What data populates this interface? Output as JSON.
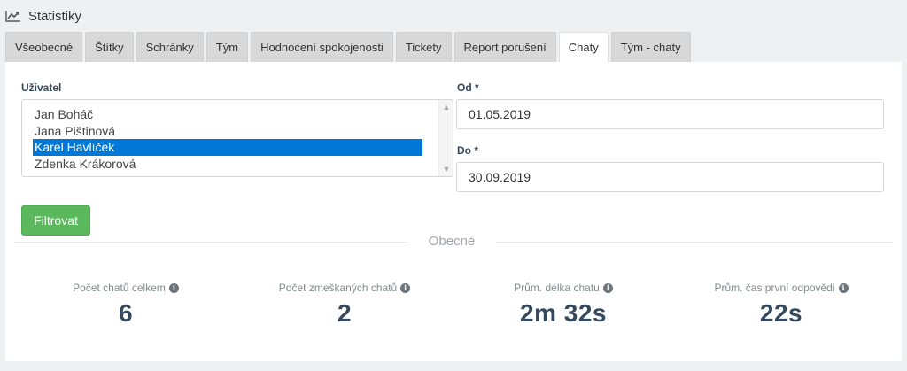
{
  "header": {
    "title": "Statistiky",
    "icon": "line-chart-icon"
  },
  "tabs": [
    {
      "label": "Všeobecné",
      "active": false
    },
    {
      "label": "Štítky",
      "active": false
    },
    {
      "label": "Schránky",
      "active": false
    },
    {
      "label": "Tým",
      "active": false
    },
    {
      "label": "Hodnocení spokojenosti",
      "active": false
    },
    {
      "label": "Tickety",
      "active": false
    },
    {
      "label": "Report porušení",
      "active": false
    },
    {
      "label": "Chaty",
      "active": true
    },
    {
      "label": "Tým - chaty",
      "active": false
    }
  ],
  "filters": {
    "user_label": "Uživatel",
    "users": [
      {
        "name": "Jan Boháč",
        "selected": false
      },
      {
        "name": "Jana Pištinová",
        "selected": false
      },
      {
        "name": "Karel Havlíček",
        "selected": true
      },
      {
        "name": "Zdenka Krákorová",
        "selected": false
      }
    ],
    "from_label": "Od *",
    "from_value": "01.05.2019",
    "to_label": "Do *",
    "to_value": "30.09.2019",
    "filter_button": "Filtrovat"
  },
  "section": {
    "title": "Obecné"
  },
  "stats": [
    {
      "label": "Počet chatů celkem",
      "value": "6"
    },
    {
      "label": "Počet zmeškaných chatů",
      "value": "2"
    },
    {
      "label": "Prům. délka chatu",
      "value": "2m 32s"
    },
    {
      "label": "Prům. čas první odpovědi",
      "value": "22s"
    }
  ],
  "colors": {
    "active_tab": "#ffffff",
    "inactive_tab": "#d8d8d8",
    "selection": "#0078d7",
    "filter_button": "#5cb85c",
    "value_text": "#34495e"
  }
}
